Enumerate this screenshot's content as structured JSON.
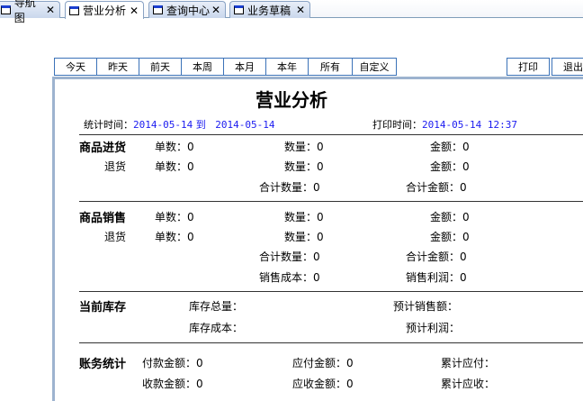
{
  "tabs": [
    {
      "label": "导航图"
    },
    {
      "label": "营业分析"
    },
    {
      "label": "查询中心"
    },
    {
      "label": "业务草稿"
    }
  ],
  "close_glyph": "✕",
  "range_buttons": [
    "今天",
    "昨天",
    "前天",
    "本周",
    "本月",
    "本年",
    "所有",
    "自定义"
  ],
  "actions": {
    "print": "打印",
    "exit": "退出"
  },
  "report": {
    "title": "营业分析",
    "stat_label": "统计时间：",
    "stat_from": "2014-05-14",
    "stat_to_word": "到",
    "stat_to": "2014-05-14",
    "print_label": "打印时间：",
    "print_time": "2014-05-14 12:37",
    "purchase": {
      "title": "商品进货",
      "return": "退货",
      "r1": [
        "单数：0",
        "数量：0",
        "金额：0"
      ],
      "r2": [
        "单数：0",
        "数量：0",
        "金额：0"
      ],
      "r3": [
        "合计数量：0",
        "合计金额：0"
      ]
    },
    "sales": {
      "title": "商品销售",
      "return": "退货",
      "r1": [
        "单数：0",
        "数量：0",
        "金额：0"
      ],
      "r2": [
        "单数：0",
        "数量：0",
        "金额：0"
      ],
      "r3": [
        "合计数量：0",
        "合计金额：0"
      ],
      "r4": [
        "销售成本：0",
        "销售利润：0"
      ]
    },
    "stock": {
      "title": "当前库存",
      "r1": [
        "库存总量：",
        "预计销售额："
      ],
      "r2": [
        "库存成本：",
        "预计利润："
      ]
    },
    "accounts": {
      "title": "账务统计",
      "r1": [
        "付款金额：0",
        "应付金额：0",
        "累计应付："
      ],
      "r2": [
        "收款金额：0",
        "应收金额：0",
        "累计应收："
      ]
    }
  }
}
